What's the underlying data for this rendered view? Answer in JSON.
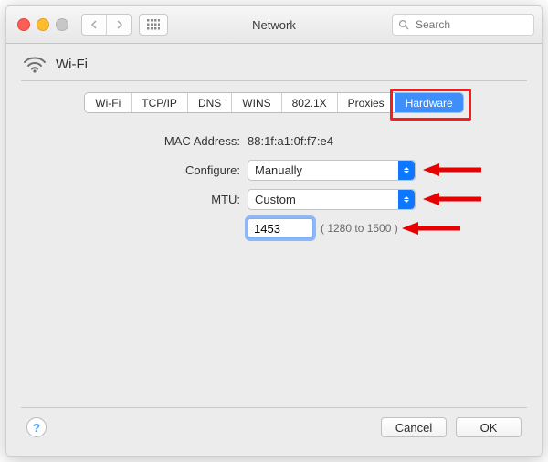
{
  "window": {
    "title": "Network"
  },
  "search": {
    "placeholder": "Search"
  },
  "heading": {
    "label": "Wi-Fi"
  },
  "tabs": {
    "items": [
      {
        "label": "Wi-Fi"
      },
      {
        "label": "TCP/IP"
      },
      {
        "label": "DNS"
      },
      {
        "label": "WINS"
      },
      {
        "label": "802.1X"
      },
      {
        "label": "Proxies"
      },
      {
        "label": "Hardware"
      }
    ],
    "active_index": 6
  },
  "form": {
    "mac_label": "MAC Address:",
    "mac_value": "88:1f:a1:0f:f7:e4",
    "configure_label": "Configure:",
    "configure_value": "Manually",
    "mtu_label": "MTU:",
    "mtu_value": "Custom",
    "mtu_number": "1453",
    "mtu_hint": "( 1280 to 1500 )"
  },
  "footer": {
    "help": "?",
    "cancel": "Cancel",
    "ok": "OK"
  }
}
